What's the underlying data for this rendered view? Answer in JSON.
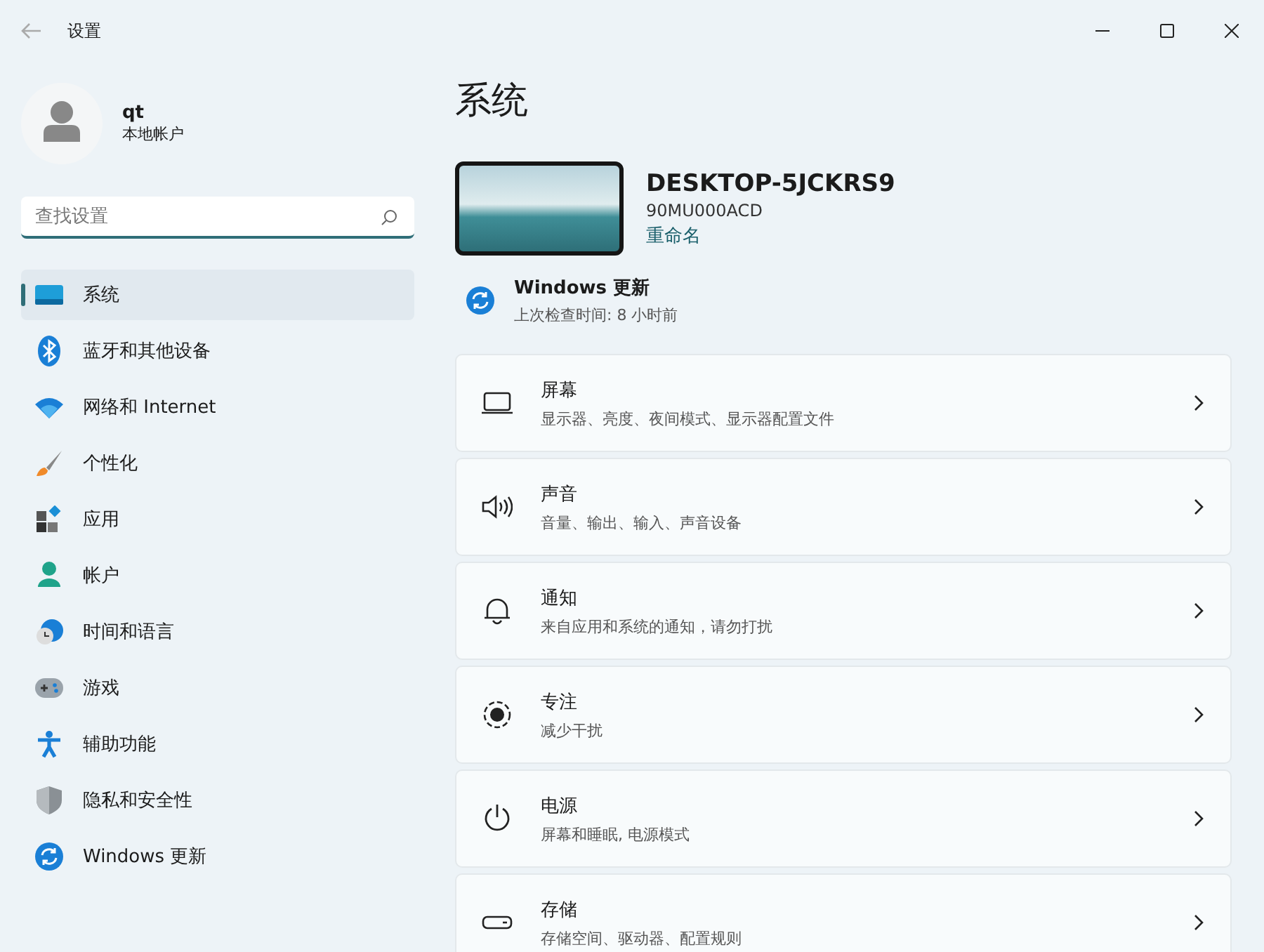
{
  "window": {
    "title": "设置"
  },
  "account": {
    "name": "qt",
    "type": "本地帐户"
  },
  "search": {
    "placeholder": "查找设置"
  },
  "sidebar": {
    "items": [
      {
        "label": "系统",
        "kind": "system",
        "selected": true
      },
      {
        "label": "蓝牙和其他设备",
        "kind": "bluetooth",
        "selected": false
      },
      {
        "label": "网络和 Internet",
        "kind": "wifi",
        "selected": false
      },
      {
        "label": "个性化",
        "kind": "brush",
        "selected": false
      },
      {
        "label": "应用",
        "kind": "apps",
        "selected": false
      },
      {
        "label": "帐户",
        "kind": "person",
        "selected": false
      },
      {
        "label": "时间和语言",
        "kind": "clock",
        "selected": false
      },
      {
        "label": "游戏",
        "kind": "gamepad",
        "selected": false
      },
      {
        "label": "辅助功能",
        "kind": "accessibility",
        "selected": false
      },
      {
        "label": "隐私和安全性",
        "kind": "shield",
        "selected": false
      },
      {
        "label": "Windows 更新",
        "kind": "update",
        "selected": false
      }
    ]
  },
  "page_title": "系统",
  "device": {
    "name": "DESKTOP-5JCKRS9",
    "model": "90MU000ACD",
    "rename": "重命名"
  },
  "update": {
    "title": "Windows 更新",
    "subtitle": "上次检查时间: 8 小时前"
  },
  "cards": [
    {
      "kind": "display",
      "title": "屏幕",
      "subtitle": "显示器、亮度、夜间模式、显示器配置文件"
    },
    {
      "kind": "sound",
      "title": "声音",
      "subtitle": "音量、输出、输入、声音设备"
    },
    {
      "kind": "bell",
      "title": "通知",
      "subtitle": "来自应用和系统的通知，请勿打扰"
    },
    {
      "kind": "focus",
      "title": "专注",
      "subtitle": "减少干扰"
    },
    {
      "kind": "power",
      "title": "电源",
      "subtitle": "屏幕和睡眠, 电源模式"
    },
    {
      "kind": "storage",
      "title": "存储",
      "subtitle": "存储空间、驱动器、配置规则"
    }
  ]
}
